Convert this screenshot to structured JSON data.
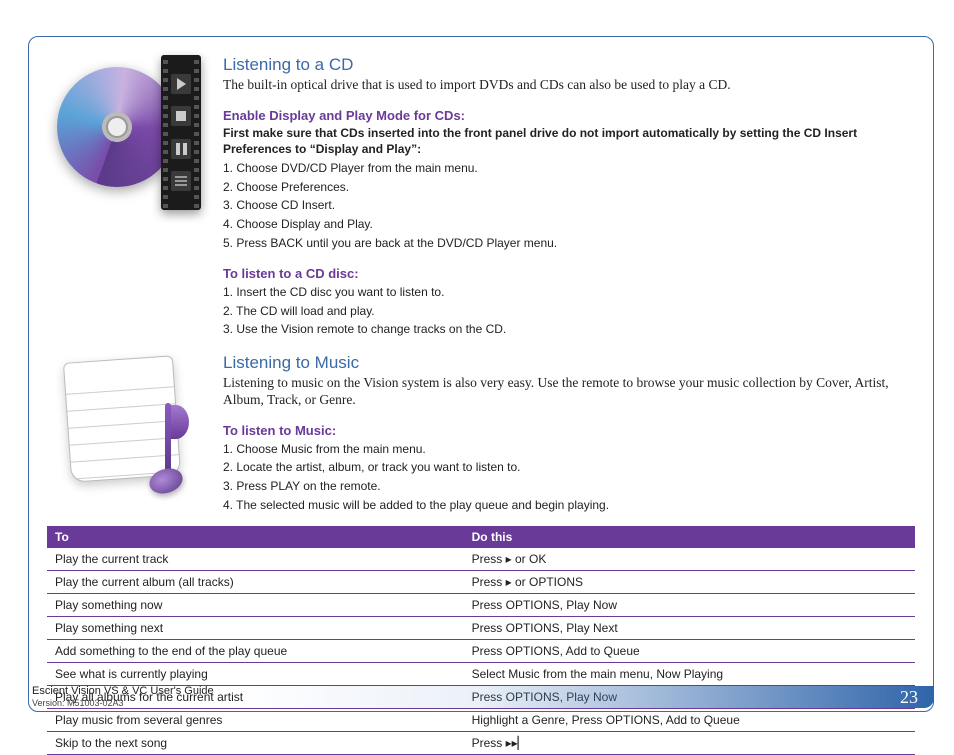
{
  "section1": {
    "title": "Listening to a CD",
    "intro": "The built-in optical drive that is used to import DVDs and CDs can also be used to play a CD.",
    "sub1": {
      "head": "Enable Display and Play Mode for CDs:",
      "bold": "First make sure that CDs inserted into the front panel drive do not import automatically by setting the CD Insert Preferences to “Display and Play”:",
      "steps": [
        "1. Choose DVD/CD Player from the main menu.",
        "2. Choose Preferences.",
        "3. Choose CD Insert.",
        "4. Choose Display and Play.",
        "5. Press BACK until you are back at the DVD/CD Player menu."
      ]
    },
    "sub2": {
      "head": "To listen to a CD disc:",
      "steps": [
        "1. Insert the CD disc you want to listen to.",
        "2. The CD will load and play.",
        "3. Use the Vision remote to change tracks on the CD."
      ]
    }
  },
  "section2": {
    "title": "Listening to Music",
    "intro": "Listening to music on the Vision system is also very easy. Use the remote to browse your music collection by Cover, Artist, Album, Track, or Genre.",
    "sub1": {
      "head": "To listen to Music:",
      "steps": [
        "1. Choose Music from the main menu.",
        "2. Locate the artist, album, or track you want to listen to.",
        "3. Press PLAY on the remote.",
        "4. The selected music will be added to the play queue and begin playing."
      ]
    }
  },
  "table": {
    "headers": [
      "To",
      "Do this"
    ],
    "rows": [
      [
        "Play the current track",
        "Press  ▸ or OK"
      ],
      [
        "Play the current album (all tracks)",
        "Press  ▸ or OPTIONS"
      ],
      [
        "Play something now",
        "Press OPTIONS, Play Now"
      ],
      [
        "Play something next",
        "Press OPTIONS, Play Next"
      ],
      [
        "Add something to the end of the play queue",
        "Press OPTIONS, Add to Queue"
      ],
      [
        "See what is currently playing",
        "Select Music from the main menu, Now Playing"
      ],
      [
        "Play all albums for the current artist",
        "Press OPTIONS, Play Now"
      ],
      [
        "Play music from several genres",
        "Highlight a Genre, Press OPTIONS, Add to Queue"
      ],
      [
        "Skip to the next song",
        "Press ▸▸▏"
      ]
    ]
  },
  "footer": {
    "title": "Escient Vision VS & VC User's Guide",
    "version": "Version: M51003-02A3",
    "page": "23"
  }
}
